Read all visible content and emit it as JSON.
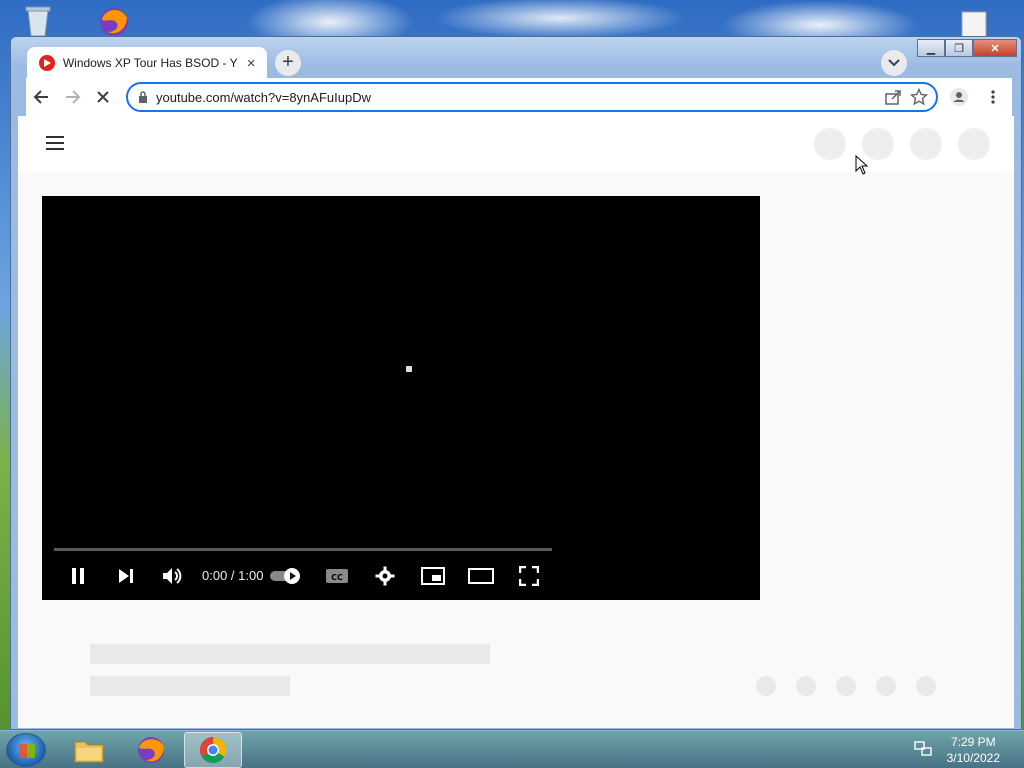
{
  "browser": {
    "tab": {
      "title": "Windows XP Tour Has BSOD - YouTube",
      "close_label": "×"
    },
    "new_tab_label": "+",
    "url": "youtube.com/watch?v=8ynAFuIupDw"
  },
  "player": {
    "time": "0:00 / 1:00",
    "progress": 0
  },
  "taskbar": {
    "time": "7:29 PM",
    "date": "3/10/2022"
  },
  "colors": {
    "accent": "#1a73e8",
    "youtube_red": "#e62117"
  }
}
